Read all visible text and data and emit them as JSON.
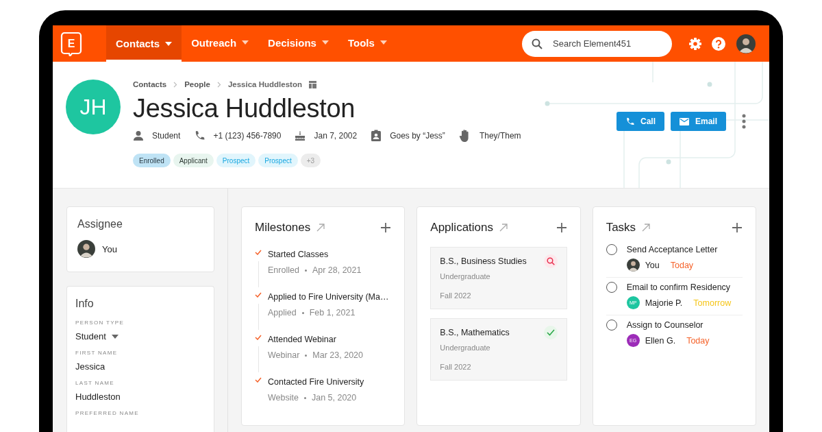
{
  "nav": {
    "logo_letter": "E",
    "tabs": [
      {
        "label": "Contacts",
        "selected": true
      },
      {
        "label": "Outreach",
        "selected": false
      },
      {
        "label": "Decisions",
        "selected": false
      },
      {
        "label": "Tools",
        "selected": false
      }
    ],
    "search": {
      "placeholder": "Search Element451"
    }
  },
  "profile": {
    "breadcrumbs": [
      "Contacts",
      "People",
      "Jessica Huddleston"
    ],
    "initials": "JH",
    "name": "Jessica Huddleston",
    "facts": [
      {
        "kind": "person",
        "text": "Student"
      },
      {
        "kind": "phone",
        "text": "+1 (123) 456-7890"
      },
      {
        "kind": "birthday",
        "text": "Jan 7, 2002"
      },
      {
        "kind": "badge",
        "text": "Goes by “Jess”"
      },
      {
        "kind": "hand",
        "text": "They/Them"
      }
    ],
    "tags": [
      {
        "kind": "enrolled",
        "label": "Enrolled"
      },
      {
        "kind": "applicant",
        "label": "Applicant"
      },
      {
        "kind": "prospect",
        "label": "Prospect"
      },
      {
        "kind": "prospect",
        "label": "Prospect"
      },
      {
        "kind": "more",
        "label": "+3"
      }
    ],
    "actions": [
      {
        "kind": "call",
        "label": "Call"
      },
      {
        "kind": "email",
        "label": "Email"
      }
    ]
  },
  "assignee": {
    "title": "Assignee",
    "name": "You"
  },
  "info": {
    "title": "Info",
    "fields": [
      {
        "kind": "select",
        "label": "PERSON TYPE",
        "value": "Student"
      },
      {
        "kind": "text",
        "label": "FIRST NAME",
        "value": "Jessica"
      },
      {
        "kind": "text",
        "label": "LAST NAME",
        "value": "Huddleston"
      },
      {
        "label": "PREFERRED NAME"
      }
    ]
  },
  "milestones": {
    "title": "Milestones",
    "items": [
      {
        "title": "Started Classes",
        "source": "Enrolled",
        "date": "Apr 28, 2021",
        "completed": true
      },
      {
        "title": "Applied to Fire University (Ma…",
        "source": "Applied",
        "date": "Feb 1, 2021",
        "completed": true
      },
      {
        "title": "Attended Webinar",
        "source": "Webinar",
        "date": "Mar 23, 2020",
        "completed": true
      },
      {
        "title": "Contacted Fire University",
        "source": "Website",
        "date": "Jan 5, 2020",
        "completed": true
      }
    ]
  },
  "applications": {
    "title": "Applications",
    "items": [
      {
        "title": "B.S., Business Studies",
        "level": "Undergraduate",
        "term": "Fall 2022",
        "kind": "review"
      },
      {
        "title": "B.S., Mathematics",
        "level": "Undergraduate",
        "term": "Fall 2022",
        "kind": "accepted"
      }
    ]
  },
  "tasks": {
    "title": "Tasks",
    "items": [
      {
        "title": "Send Acceptance Letter",
        "done": false,
        "assignee": {
          "kind": "photo",
          "name": "You"
        },
        "due": {
          "text": "Today",
          "color": "#f5622a"
        }
      },
      {
        "title": "Email to confirm Residency",
        "done": false,
        "assignee": {
          "kind": "initials",
          "initials": "MP",
          "color": "#1ec6a0",
          "name": "Majorie P."
        },
        "due": {
          "text": "Tomorrow",
          "color": "#f5c518"
        }
      },
      {
        "title": "Assign to Counselor",
        "done": false,
        "assignee": {
          "kind": "initials",
          "initials": "EG",
          "color": "#9c2cb8",
          "name": "Ellen G."
        },
        "due": {
          "text": "Today",
          "color": "#f5622a"
        }
      }
    ]
  }
}
